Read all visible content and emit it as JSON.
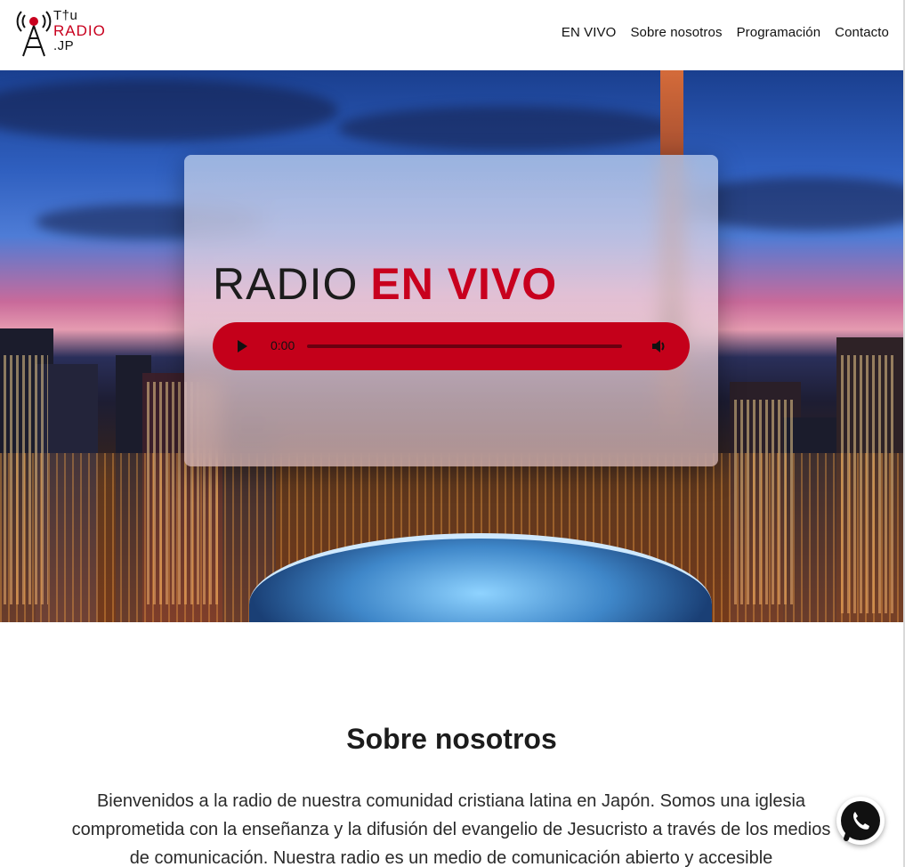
{
  "logo": {
    "line1": "T†u",
    "line2": "RADIO",
    "line3": ".JP",
    "icon": "radio-tower-icon"
  },
  "nav": {
    "items": [
      "EN VIVO",
      "Sobre nosotros",
      "Programación",
      "Contacto"
    ]
  },
  "hero": {
    "title_part1": "RADIO",
    "title_part2": "EN VIVO",
    "player": {
      "time": "0:00",
      "play_icon": "play-icon",
      "volume_icon": "volume-icon"
    }
  },
  "about": {
    "title": "Sobre nosotros",
    "text": "Bienvenidos a la radio de nuestra comunidad cristiana latina en Japón. Somos una iglesia comprometida con la enseñanza y la difusión del evangelio de Jesucristo a través de los medios de comunicación. Nuestra radio es un medio de comunicación abierto y accesible"
  },
  "floating": {
    "whatsapp_icon": "whatsapp-icon"
  },
  "colors": {
    "accent": "#c8001e",
    "player": "#c4001a"
  }
}
